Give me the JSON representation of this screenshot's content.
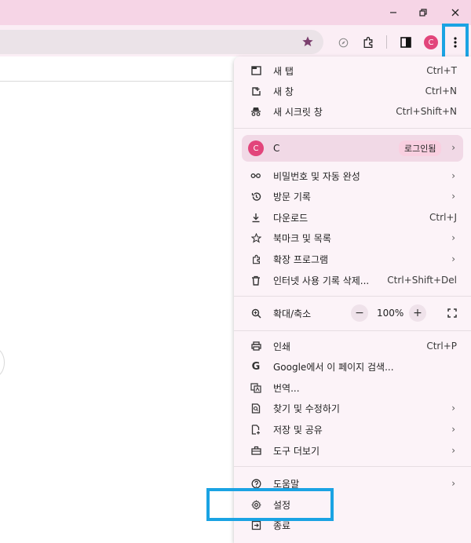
{
  "window": {
    "minimize_icon": "minimize-icon",
    "restore_icon": "restore-icon",
    "close_icon": "close-icon"
  },
  "toolbar": {
    "bookmark_star_icon": "star-icon",
    "profile_initial": "C"
  },
  "menu": {
    "group1": [
      {
        "label": "새 탭",
        "shortcut": "Ctrl+T",
        "icon": "new-tab-icon"
      },
      {
        "label": "새 창",
        "shortcut": "Ctrl+N",
        "icon": "new-window-icon"
      },
      {
        "label": "새 시크릿 창",
        "shortcut": "Ctrl+Shift+N",
        "icon": "incognito-icon"
      }
    ],
    "profile": {
      "initial": "C",
      "name": "C",
      "badge": "로그인됨"
    },
    "group2": [
      {
        "label": "비밀번호 및 자동 완성",
        "shortcut": "",
        "icon": "key-icon"
      },
      {
        "label": "방문 기록",
        "shortcut": "",
        "icon": "history-icon"
      },
      {
        "label": "다운로드",
        "shortcut": "Ctrl+J",
        "icon": "download-icon"
      },
      {
        "label": "북마크 및 목록",
        "shortcut": "",
        "icon": "star-outline-icon"
      },
      {
        "label": "확장 프로그램",
        "shortcut": "",
        "icon": "puzzle-icon"
      },
      {
        "label": "인터넷 사용 기록 삭제...",
        "shortcut": "Ctrl+Shift+Del",
        "icon": "trash-icon"
      }
    ],
    "zoom": {
      "label": "확대/축소",
      "minus": "−",
      "value": "100%",
      "plus": "+"
    },
    "group3": [
      {
        "label": "인쇄",
        "shortcut": "Ctrl+P",
        "icon": "print-icon"
      },
      {
        "label": "Google에서 이 페이지 검색...",
        "shortcut": "",
        "icon": "google-icon"
      },
      {
        "label": "번역...",
        "shortcut": "",
        "icon": "translate-icon"
      },
      {
        "label": "찾기 및 수정하기",
        "shortcut": "",
        "icon": "find-icon"
      },
      {
        "label": "저장 및 공유",
        "shortcut": "",
        "icon": "save-share-icon"
      },
      {
        "label": "도구 더보기",
        "shortcut": "",
        "icon": "toolbox-icon"
      }
    ],
    "group4": [
      {
        "label": "도움말",
        "shortcut": "",
        "icon": "help-icon"
      },
      {
        "label": "설정",
        "shortcut": "",
        "icon": "settings-gear-icon"
      },
      {
        "label": "종료",
        "shortcut": "",
        "icon": "exit-icon"
      }
    ]
  },
  "colors": {
    "title_bar": "#f6d5e6",
    "menu_bg": "#fcf3f8",
    "highlight": "#1aa3e3",
    "avatar": "#e2457b"
  }
}
